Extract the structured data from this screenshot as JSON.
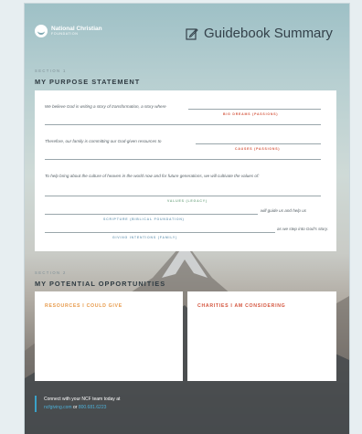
{
  "logo": {
    "name": "National Christian",
    "sub": "FOUNDATION"
  },
  "header": {
    "title": "Guidebook Summary",
    "icon": "edit-note-icon"
  },
  "section1": {
    "num": "SECTION 1",
    "title": "MY PURPOSE STATEMENT",
    "line1": "We believe God is writing a story of transformation, a story where",
    "label1": "BIG DREAMS (PASSIONS)",
    "line2": "Therefore, our family is committing our God-given resources to",
    "label2": "CAUSES (PASSIONS)",
    "line3": "To help bring about the culture of heaven in the world now and for future generations, we will cultivate the values of:",
    "label3": "VALUES (LEGACY)",
    "line4_end": "will guide us and help us",
    "label4": "SCRIPTURE (BIBLICAL FOUNDATION)",
    "line5_end": "as we step into God’s story.",
    "label5": "GIVING INTENTIONS (FAMILY)"
  },
  "section2": {
    "num": "SECTION 2",
    "title": "MY POTENTIAL OPPORTUNITIES",
    "box1": "RESOURCES I COULD GIVE",
    "box2": "CHARITIES I AM CONSIDERING"
  },
  "footer": {
    "line1": "Connect with your NCF team today at",
    "link": "ncfgiving.com",
    "or": "or",
    "phone": "800.681.6223"
  },
  "colors": {
    "accent_red": "#d4563f",
    "accent_orange": "#e79a4b",
    "accent_green": "#7fae8e",
    "accent_blue": "#7fa6be",
    "link": "#4db0d8"
  }
}
